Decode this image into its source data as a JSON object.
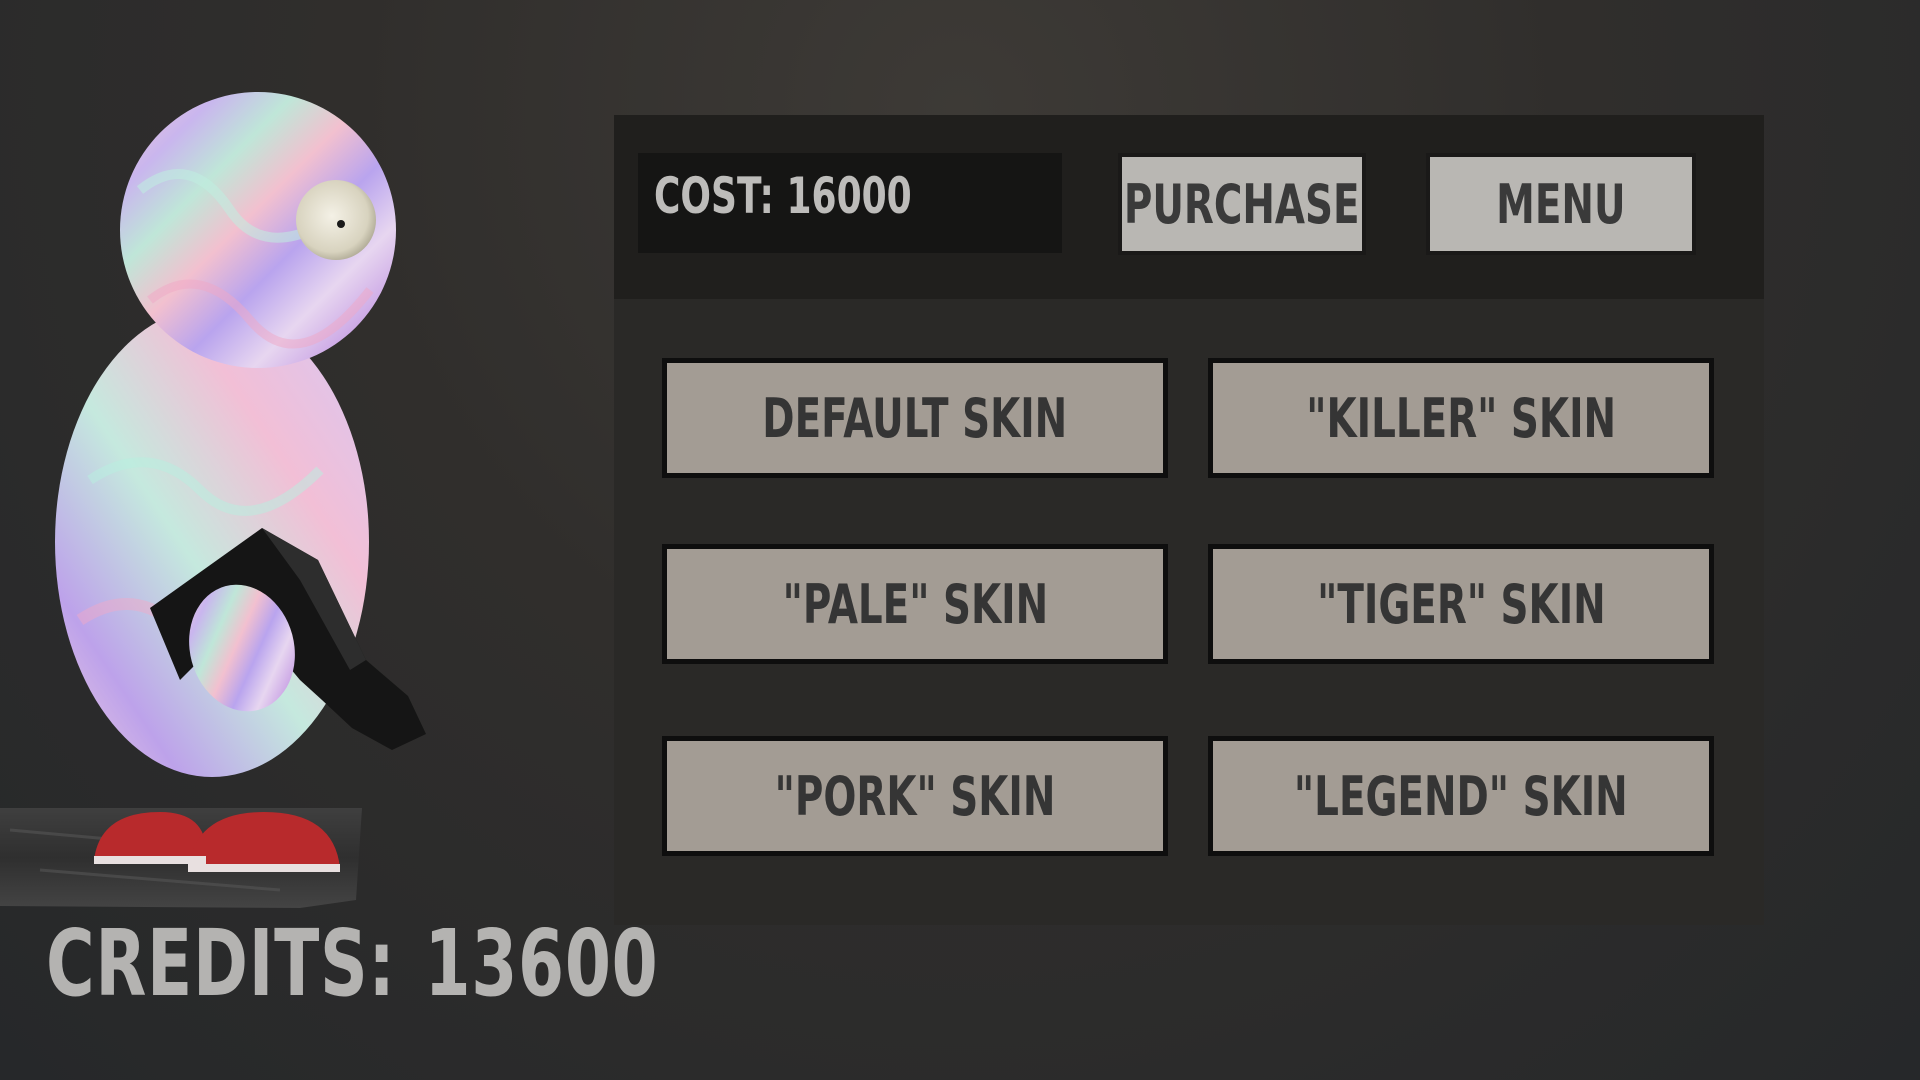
{
  "cost": {
    "label": "COST: 16000"
  },
  "actions": {
    "purchase_label": "PURCHASE",
    "menu_label": "MENU"
  },
  "skins": [
    {
      "label": "DEFAULT SKIN"
    },
    {
      "label": "\"KILLER\" SKIN"
    },
    {
      "label": "\"PALE\" SKIN"
    },
    {
      "label": "\"TIGER\" SKIN"
    },
    {
      "label": "\"PORK\" SKIN"
    },
    {
      "label": "\"LEGEND\" SKIN"
    }
  ],
  "credits": {
    "label": "CREDITS:",
    "value": "13600"
  },
  "colors": {
    "background": "#302e2c",
    "panel": "#2a2927",
    "panel_header": "#201f1d",
    "cost_box": "#151514",
    "light_button": "#b9b7b3",
    "skin_button": "#a39c94",
    "text_light": "#b4b3b1",
    "shoe_red": "#b82a2c"
  },
  "icons": {
    "character": "holographic-penguin-character-with-pistol",
    "ledge": "stone-ledge"
  }
}
